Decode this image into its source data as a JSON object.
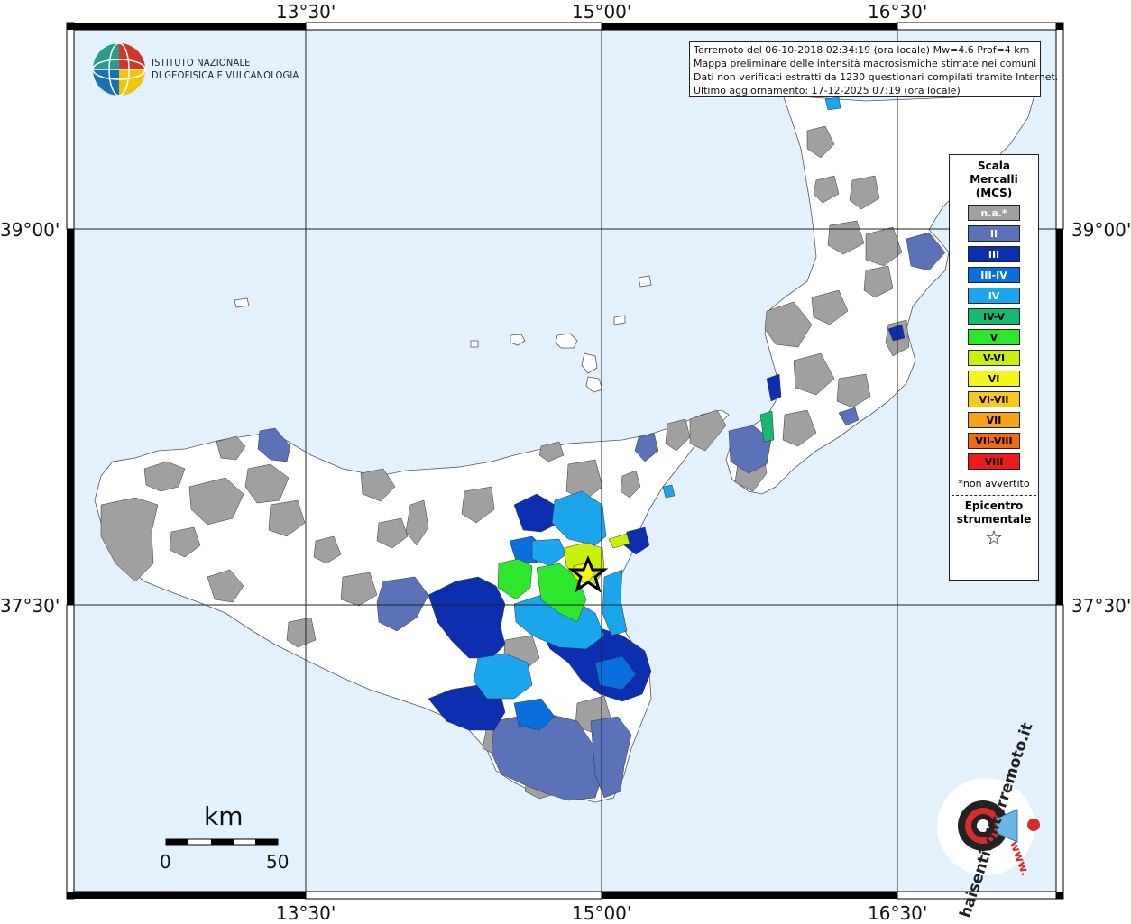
{
  "map": {
    "graticule": {
      "top_lon": [
        "13°30'",
        "15°00'",
        "16°30'"
      ],
      "bottom_lon": [
        "13°30'",
        "15°00'",
        "16°30'"
      ],
      "left_lat": [
        "39°00'",
        "37°30'"
      ],
      "right_lat": [
        "39°00'",
        "37°30'"
      ]
    },
    "colors": {
      "sea": "#e2f1fb",
      "land": "#ffffff",
      "na": "#a0a0a0",
      "II": "#5b72b8",
      "III": "#0c2fb0",
      "III-IV": "#0a6fdc",
      "IV": "#1aa5ec",
      "IV-V": "#18b870",
      "V": "#2ee62e",
      "V-VI": "#c8f00a",
      "VI": "#f5f51e"
    }
  },
  "info": {
    "line1": "Terremoto del 06-10-2018 02:34:19 (ora locale) Mw=4.6 Prof=4 km",
    "line2": "Mappa preliminare delle intensità macrosismiche stimate nei comuni",
    "line3": "Dati non verificati estratti da 1230 questionari compilati tramite Internet.",
    "line4": "Ultimo aggiornamento: 17-12-2025 07:19 (ora locale)"
  },
  "logo": {
    "line1": "ISTITUTO NAZIONALE",
    "line2": "DI GEOFISICA E VULCANOLOGIA"
  },
  "legend": {
    "title1": "Scala",
    "title2": "Mercalli",
    "title3": "(MCS)",
    "items": [
      {
        "label": "n.a.*",
        "color": "#a0a0a0"
      },
      {
        "label": "II",
        "color": "#5b72b8"
      },
      {
        "label": "III",
        "color": "#0c2fb0"
      },
      {
        "label": "III-IV",
        "color": "#0a6fdc"
      },
      {
        "label": "IV",
        "color": "#1aa5ec"
      },
      {
        "label": "IV-V",
        "color": "#18b870"
      },
      {
        "label": "V",
        "color": "#2ee62e"
      },
      {
        "label": "V-VI",
        "color": "#c8f00a"
      },
      {
        "label": "VI",
        "color": "#f5f51e"
      },
      {
        "label": "VI-VII",
        "color": "#f8c81e"
      },
      {
        "label": "VII",
        "color": "#f7a11a"
      },
      {
        "label": "VII-VIII",
        "color": "#f06a14"
      },
      {
        "label": "VIII",
        "color": "#ee1b1b"
      }
    ],
    "note": "*non avvertito",
    "epi1": "Epicentro",
    "epi2": "strumentale",
    "star": "☆"
  },
  "scale": {
    "unit": "km",
    "min": "0",
    "max": "50"
  },
  "haisentito": {
    "text": "haisentitoilterremoto.it",
    "www": "www."
  }
}
